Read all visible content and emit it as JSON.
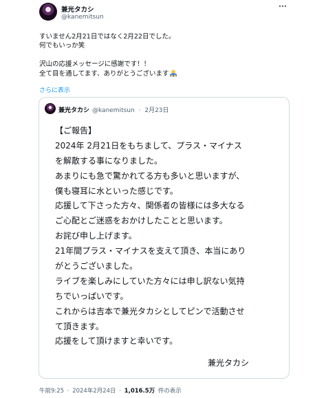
{
  "author": {
    "name": "兼光タカシ",
    "handle": "@kanemitsun"
  },
  "body": {
    "lines": [
      "すいません2月21日ではなく2月22日でした。",
      "何でもいっか笑",
      "沢山の応援メッセージに感謝です！！",
      "全て目を通してます、ありがとうございます"
    ],
    "show_more": "さらに表示",
    "emoji_icon": "bowing-person-icon"
  },
  "quote": {
    "name": "兼光タカシ",
    "handle": "@kanemitsun",
    "separator": "·",
    "date": "2月23日",
    "lines": [
      "【ご報告】",
      "2024年 2月21日をもちまして、プラス・マイナス",
      "を解散する事になりました。",
      "あまりにも急で驚かれてる方も多いと思いますが、",
      "僕も寝耳に水といった感じです。",
      "応援して下さった方々、関係者の皆様には多大なる",
      "ご心配とご迷惑をおかけしたことと思います。",
      "お詫び申し上げます。",
      "21年間プラス・マイナスを支えて頂き、本当にあり",
      "がとうございました。",
      "ライブを楽しみにしていた方々には申し訳ない気持",
      "ちでいっぱいです。",
      "これからは吉本で兼光タカシとしてピンで活動させ",
      "て頂きます。",
      "応援をして頂けますと幸いです。"
    ],
    "signature": "兼光タカシ"
  },
  "footer": {
    "time": "午前9:25",
    "separator": "·",
    "date": "2024年2月24日",
    "views": "1,016.5万",
    "views_label": "件の表示"
  },
  "icons": {
    "more": "more-options-icon"
  }
}
